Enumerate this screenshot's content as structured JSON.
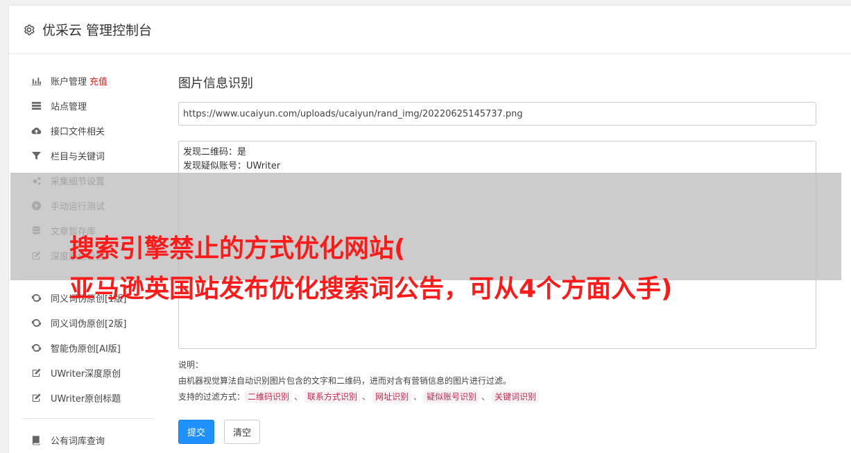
{
  "header": {
    "title": "优采云 管理控制台",
    "icon": "gear-icon"
  },
  "sidebar": {
    "group1": [
      {
        "label": "账户管理",
        "extra": "充值",
        "icon": "bar-chart-icon"
      },
      {
        "label": "站点管理",
        "icon": "server-icon"
      },
      {
        "label": "接口文件相关",
        "icon": "cloud-upload-icon"
      },
      {
        "label": "栏目与关键词",
        "icon": "filter-icon"
      },
      {
        "label": "采集细节设置",
        "icon": "gears-icon"
      },
      {
        "label": "手动运行测试",
        "icon": "play-circle-icon"
      },
      {
        "label": "文章暂存库",
        "icon": "database-icon"
      },
      {
        "label": "深度原创设置",
        "icon": "edit-icon"
      }
    ],
    "group2": [
      {
        "label": "同义词伪原创[1版]",
        "icon": "refresh-icon"
      },
      {
        "label": "同义词伪原创[2版]",
        "icon": "refresh-icon"
      },
      {
        "label": "智能伪原创[AI版]",
        "icon": "refresh-icon"
      },
      {
        "label": "UWriter深度原创",
        "icon": "edit-icon"
      },
      {
        "label": "UWriter原创标题",
        "icon": "edit-icon"
      }
    ],
    "group3": [
      {
        "label": "公有词库查询",
        "icon": "book-icon"
      }
    ]
  },
  "main": {
    "title": "图片信息识别",
    "url_value": "https://www.ucaiyun.com/uploads/ucaiyun/rand_img/20220625145737.png",
    "result_lines": [
      "发现二维码：是",
      "发现疑似账号：UWriter"
    ],
    "desc_label": "说明：",
    "desc_text": "由机器视觉算法自动识别图片包含的文字和二维码，进而对含有营销信息的图片进行过滤。",
    "filter_label": "支持的过滤方式：",
    "filter_tags": [
      "二维码识别",
      "联系方式识别",
      "网址识别",
      "疑似账号识别",
      "关键词识别"
    ],
    "separator": "、",
    "submit_label": "提交",
    "clear_label": "清空"
  },
  "overlay": {
    "line1": "搜索引擎禁止的方式优化网站(",
    "line2": "亚马逊英国站发布优化搜索词公告，可从4个方面入手)"
  },
  "colors": {
    "accent": "#1e90ff",
    "recharge": "#e02020",
    "overlay_text": "#ff1a1a",
    "tag_text": "#c7254e"
  }
}
